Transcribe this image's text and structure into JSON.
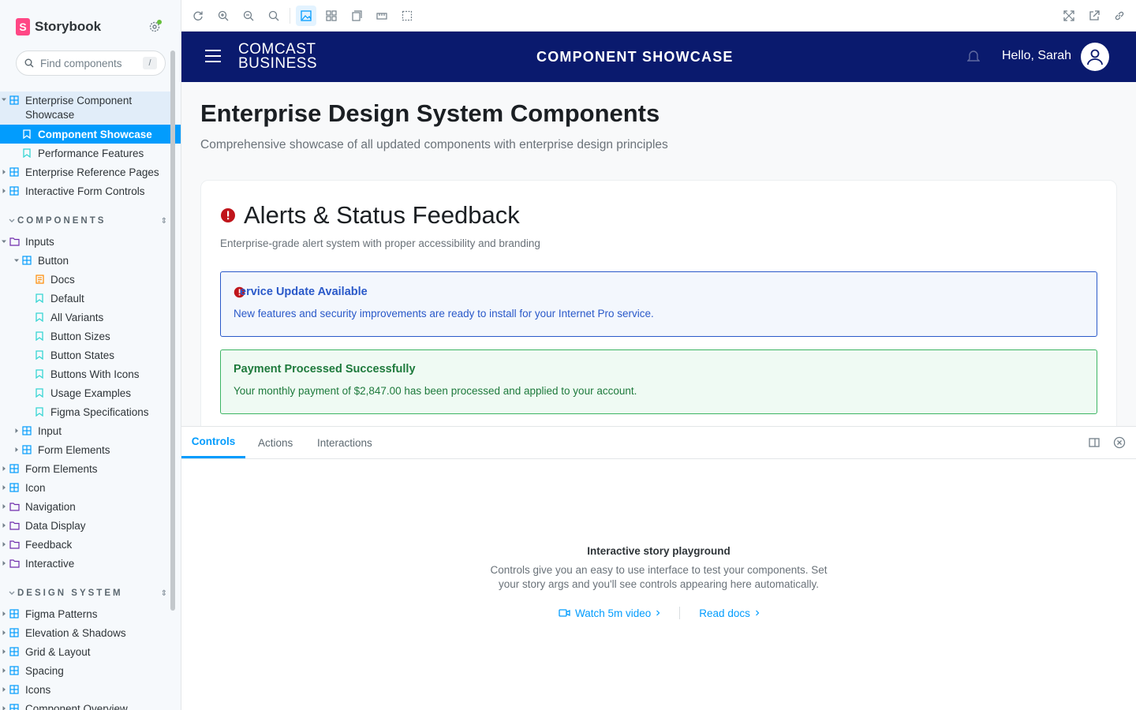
{
  "sidebar": {
    "brand": "Storybook",
    "search_placeholder": "Find components",
    "search_shortcut": "/",
    "items": [
      {
        "label": "Enterprise Component Showcase",
        "line1": "Enterprise Component",
        "line2": "Showcase"
      },
      {
        "label": "Component Showcase"
      },
      {
        "label": "Performance Features"
      },
      {
        "label": "Enterprise Reference Pages"
      },
      {
        "label": "Interactive Form Controls"
      }
    ],
    "sections": [
      {
        "title": "COMPONENTS"
      },
      {
        "title": "DESIGN SYSTEM"
      }
    ],
    "components": [
      {
        "label": "Inputs"
      },
      {
        "label": "Button"
      },
      {
        "label": "Docs"
      },
      {
        "label": "Default"
      },
      {
        "label": "All Variants"
      },
      {
        "label": "Button Sizes"
      },
      {
        "label": "Button States"
      },
      {
        "label": "Buttons With Icons"
      },
      {
        "label": "Usage Examples"
      },
      {
        "label": "Figma Specifications"
      },
      {
        "label": "Input"
      },
      {
        "label": "Form Elements"
      },
      {
        "label": "Form Elements"
      },
      {
        "label": "Icon"
      },
      {
        "label": "Navigation"
      },
      {
        "label": "Data Display"
      },
      {
        "label": "Feedback"
      },
      {
        "label": "Interactive"
      }
    ],
    "design_system": [
      {
        "label": "Figma Patterns"
      },
      {
        "label": "Elevation & Shadows"
      },
      {
        "label": "Grid & Layout"
      },
      {
        "label": "Spacing"
      },
      {
        "label": "Icons"
      },
      {
        "label": "Component Overview"
      }
    ]
  },
  "preview": {
    "header": {
      "logo_line1": "COMCAST",
      "logo_line2": "BUSINESS",
      "title": "COMPONENT SHOWCASE",
      "greeting": "Hello, Sarah"
    },
    "page_title": "Enterprise Design System Components",
    "page_subtitle": "Comprehensive showcase of all updated components with enterprise design principles",
    "card": {
      "title": "Alerts & Status Feedback",
      "description": "Enterprise-grade alert system with proper accessibility and branding",
      "alerts": [
        {
          "title": "ervice Update Available",
          "body": "New features and security improvements are ready to install for your Internet Pro service."
        },
        {
          "title": "Payment Processed Successfully",
          "body": "Your monthly payment of $2,847.00 has been processed and applied to your account."
        }
      ]
    }
  },
  "panel": {
    "tabs": [
      "Controls",
      "Actions",
      "Interactions"
    ],
    "empty_title": "Interactive story playground",
    "empty_desc": "Controls give you an easy to use interface to test your components. Set your story args and you'll see controls appearing here automatically.",
    "link_video": "Watch 5m video",
    "link_docs": "Read docs"
  },
  "colors": {
    "accent": "#029cfd",
    "header_navy": "#0a1a6e",
    "info_blue": "#2a59c9",
    "success_green": "#1e7a3c",
    "error_red": "#c0151b"
  }
}
